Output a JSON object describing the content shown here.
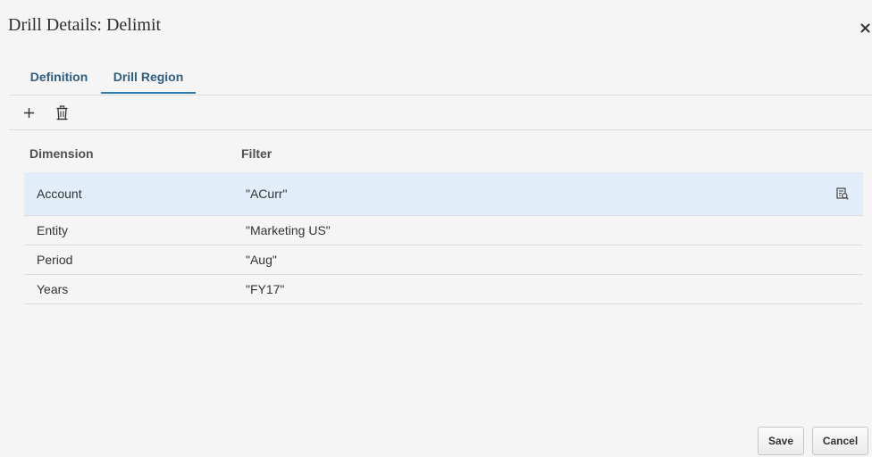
{
  "dialog": {
    "title": "Drill Details: Delimit",
    "close_icon": "close-icon"
  },
  "tabs": [
    {
      "label": "Definition",
      "selected": false
    },
    {
      "label": "Drill Region",
      "selected": true
    }
  ],
  "toolbar": {
    "add_icon": "plus-icon",
    "delete_icon": "trash-icon"
  },
  "table": {
    "columns": [
      "Dimension",
      "Filter"
    ],
    "rows": [
      {
        "dimension": "Account",
        "filter": "\"ACurr\"",
        "selected": true,
        "action_icon": "member-selector-icon"
      },
      {
        "dimension": "Entity",
        "filter": "\"Marketing US\"",
        "selected": false
      },
      {
        "dimension": "Period",
        "filter": "\"Aug\"",
        "selected": false
      },
      {
        "dimension": "Years",
        "filter": "\"FY17\"",
        "selected": false
      }
    ]
  },
  "footer": {
    "save_label": "Save",
    "cancel_label": "Cancel"
  },
  "colors": {
    "background": "#f5f5f5",
    "accent": "#2b7bba",
    "tab_text": "#2f5e80",
    "selected_row": "#e1edf8"
  }
}
